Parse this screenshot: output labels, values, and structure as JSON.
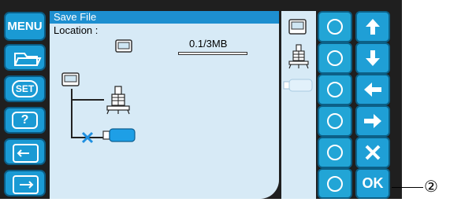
{
  "left_menu": {
    "menu_label": "MENU",
    "set_label": "SET",
    "help_label": "?"
  },
  "dialog": {
    "title": "Save File",
    "location_label": "Location :",
    "capacity_text": "0.1/3MB"
  },
  "right_buttons": {
    "ok_label": "OK"
  },
  "callout_label": "②",
  "colors": {
    "accent_blue": "#1f9fd6",
    "panel_bg": "#d7eaf6",
    "title_bar": "#1d8fd0",
    "frame": "#1f1f1f",
    "usb_blue": "#1e9fe6",
    "x_mark": "#1e8fe0"
  },
  "icons": {
    "machine": "embroidery-machine-icon",
    "memory": "machine-memory-icon",
    "usb": "usb-stick-icon"
  }
}
